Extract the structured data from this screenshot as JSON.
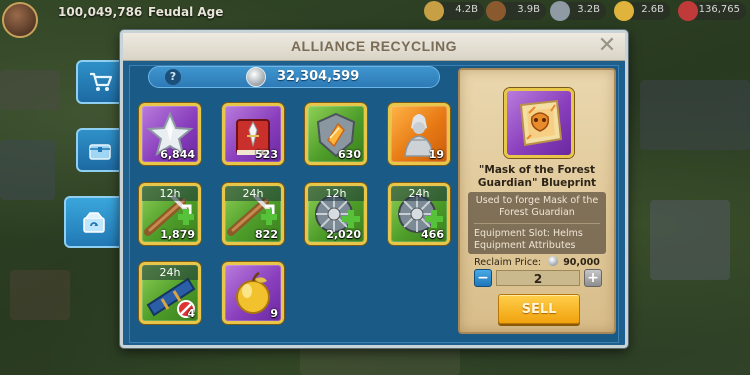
{
  "hud": {
    "power": "100,049,786",
    "age": "Feudal Age",
    "resources": [
      "4.2B",
      "3.9B",
      "3.2B",
      "2.6B",
      "136,765"
    ]
  },
  "side_tabs": [
    {
      "icon": "cart-icon"
    },
    {
      "icon": "chest-icon"
    },
    {
      "icon": "recycle-box-icon",
      "active": true
    }
  ],
  "dialog": {
    "title": "ALLIANCE RECYCLING",
    "close_icon": "close-icon"
  },
  "balance": {
    "help_label": "?",
    "coin_icon": "alliance-coin-icon",
    "amount": "32,304,599"
  },
  "items": [
    {
      "icon": "silver-star-icon",
      "rarity": "purple",
      "count": "6,844",
      "timer": ""
    },
    {
      "icon": "red-book-icon",
      "rarity": "purple",
      "count": "523",
      "timer": ""
    },
    {
      "icon": "shield-crystal-icon",
      "rarity": "green",
      "count": "630",
      "timer": ""
    },
    {
      "icon": "statue-icon",
      "rarity": "orange",
      "count": "19",
      "timer": ""
    },
    {
      "icon": "lumber-speedup-icon",
      "rarity": "green",
      "count": "1,879",
      "timer": "12h"
    },
    {
      "icon": "lumber-speedup-icon",
      "rarity": "green",
      "count": "822",
      "timer": "24h"
    },
    {
      "icon": "shield-speedup-icon",
      "rarity": "green",
      "count": "2,020",
      "timer": "12h"
    },
    {
      "icon": "shield-speedup-icon",
      "rarity": "green",
      "count": "466",
      "timer": "24h"
    },
    {
      "icon": "telescope-icon",
      "rarity": "green",
      "count": "4",
      "timer": "24h"
    },
    {
      "icon": "golden-apple-icon",
      "rarity": "purple",
      "count": "9",
      "timer": ""
    }
  ],
  "detail": {
    "icon": "blueprint-scroll-icon",
    "name_line1": "\"Mask of the Forest",
    "name_line2": "Guardian\" Blueprint",
    "description": "Used to forge Mask of the Forest Guardian",
    "slot": "Equipment Slot: Helms",
    "attributes": "Equipment Attributes",
    "reclaim_label": "Reclaim Price:",
    "reclaim_value": "90,000",
    "quantity": "2",
    "sell_label": "SELL"
  },
  "colors": {
    "dialog_blue": "#1e5f8e",
    "gold_border": "#e7c64a",
    "sell_button": "#f1a20e"
  }
}
